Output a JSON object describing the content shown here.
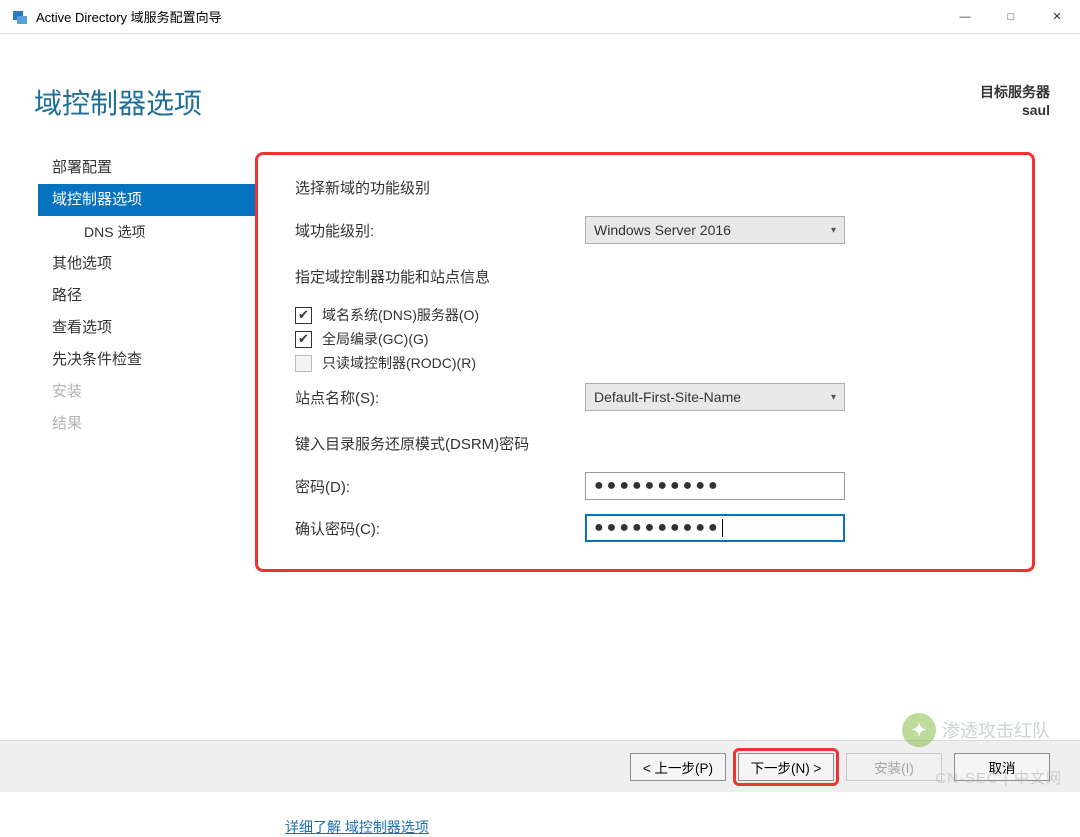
{
  "window": {
    "title": "Active Directory 域服务配置向导"
  },
  "header": {
    "page_title": "域控制器选项",
    "target_label": "目标服务器",
    "target_name": "saul"
  },
  "sidebar": {
    "items": [
      {
        "label": "部署配置",
        "active": false,
        "sub": false,
        "disabled": false
      },
      {
        "label": "域控制器选项",
        "active": true,
        "sub": false,
        "disabled": false
      },
      {
        "label": "DNS 选项",
        "active": false,
        "sub": true,
        "disabled": false
      },
      {
        "label": "其他选项",
        "active": false,
        "sub": false,
        "disabled": false
      },
      {
        "label": "路径",
        "active": false,
        "sub": false,
        "disabled": false
      },
      {
        "label": "查看选项",
        "active": false,
        "sub": false,
        "disabled": false
      },
      {
        "label": "先决条件检查",
        "active": false,
        "sub": false,
        "disabled": false
      },
      {
        "label": "安装",
        "active": false,
        "sub": false,
        "disabled": true
      },
      {
        "label": "结果",
        "active": false,
        "sub": false,
        "disabled": true
      }
    ]
  },
  "form": {
    "section1_title": "选择新域的功能级别",
    "domain_level_label": "域功能级别:",
    "domain_level_value": "Windows Server 2016",
    "section2_title": "指定域控制器功能和站点信息",
    "chk_dns": "域名系统(DNS)服务器(O)",
    "chk_gc": "全局编录(GC)(G)",
    "chk_rodc": "只读域控制器(RODC)(R)",
    "site_label": "站点名称(S):",
    "site_value": "Default-First-Site-Name",
    "section3_title": "键入目录服务还原模式(DSRM)密码",
    "pw_label": "密码(D):",
    "pw_value": "●●●●●●●●●●",
    "pw2_label": "确认密码(C):",
    "pw2_value": "●●●●●●●●●●",
    "more_link": "详细了解 域控制器选项"
  },
  "footer": {
    "prev": "< 上一步(P)",
    "next": "下一步(N) >",
    "install": "安装(I)",
    "cancel": "取消"
  },
  "watermark": {
    "text": "渗透攻击红队",
    "bottom": "CN-SEC | 中文网"
  }
}
